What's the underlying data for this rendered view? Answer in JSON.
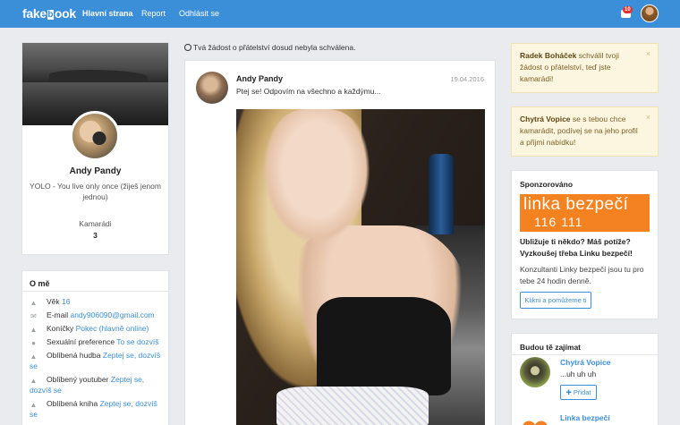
{
  "navbar": {
    "brand_part1": "fake",
    "brand_mark": "b",
    "brand_part2": "ook",
    "links": [
      "Hlavní strana",
      "Report",
      "Odhlásit se"
    ],
    "notification_count": "10",
    "bg_color": "#3b8fd9"
  },
  "profile": {
    "name": "Andy Pandy",
    "status": "YOLO - You live only once (žiješ jenom jednou)",
    "friends_label": "Kamarádi",
    "friends_count": "3"
  },
  "about": {
    "title": "O mě",
    "rows": [
      {
        "icon": "user-icon",
        "label": "Věk",
        "value": "16"
      },
      {
        "icon": "envelope-icon",
        "label": "E-mail",
        "value": "andy906090@gmail.com"
      },
      {
        "icon": "user-icon",
        "label": "Koníčky",
        "value": "Pokec (hlavně online)"
      },
      {
        "icon": "map-marker-icon",
        "label": "Sexuální preference",
        "value": "To se dozvíš"
      },
      {
        "icon": "user-icon",
        "label": "Oblíbená hudba",
        "value": "Zeptej se, dozvíš se"
      },
      {
        "icon": "user-icon",
        "label": "Oblíbený youtuber",
        "value": "Zeptej se, dozvíš se"
      },
      {
        "icon": "user-icon",
        "label": "Oblíbená kniha",
        "value": "Zeptej se, dozvíš se"
      }
    ]
  },
  "feed": {
    "pending_notice": "Tvá žádost o přátelství dosud nebyla schválena.",
    "post": {
      "author": "Andy Pandy",
      "text": "Ptej se! Odpovím na všechno a každýmu...",
      "date": "19.04.2016"
    }
  },
  "alerts": [
    {
      "name": "Radek Boháček",
      "text": " schválil tvoji žádost o přátelství, teď jste kamarádi!"
    },
    {
      "name": "Chytrá Vopice",
      "text": " se s tebou chce kamarádit, podívej se na jeho profil a přijmi nabídku!"
    }
  ],
  "sponsored": {
    "title": "Sponzorováno",
    "banner_line1": "linka bezpečí",
    "banner_line2": "116 111",
    "headline": "Ubližuje ti někdo? Máš potíže? Vyzkoušej třeba Linku bezpečí!",
    "body": "Konzultanti Linky bezpečí jsou tu pro tebe 24 hodin denně.",
    "button": "Klikni a pomůžeme ti",
    "accent_color": "#f58220"
  },
  "suggestions": {
    "title": "Budou tě zajímat",
    "items": [
      {
        "name": "Chytrá Vopice",
        "status": "...uh uh uh",
        "button": "Přidat"
      },
      {
        "name": "Linka bezpečí"
      }
    ]
  }
}
